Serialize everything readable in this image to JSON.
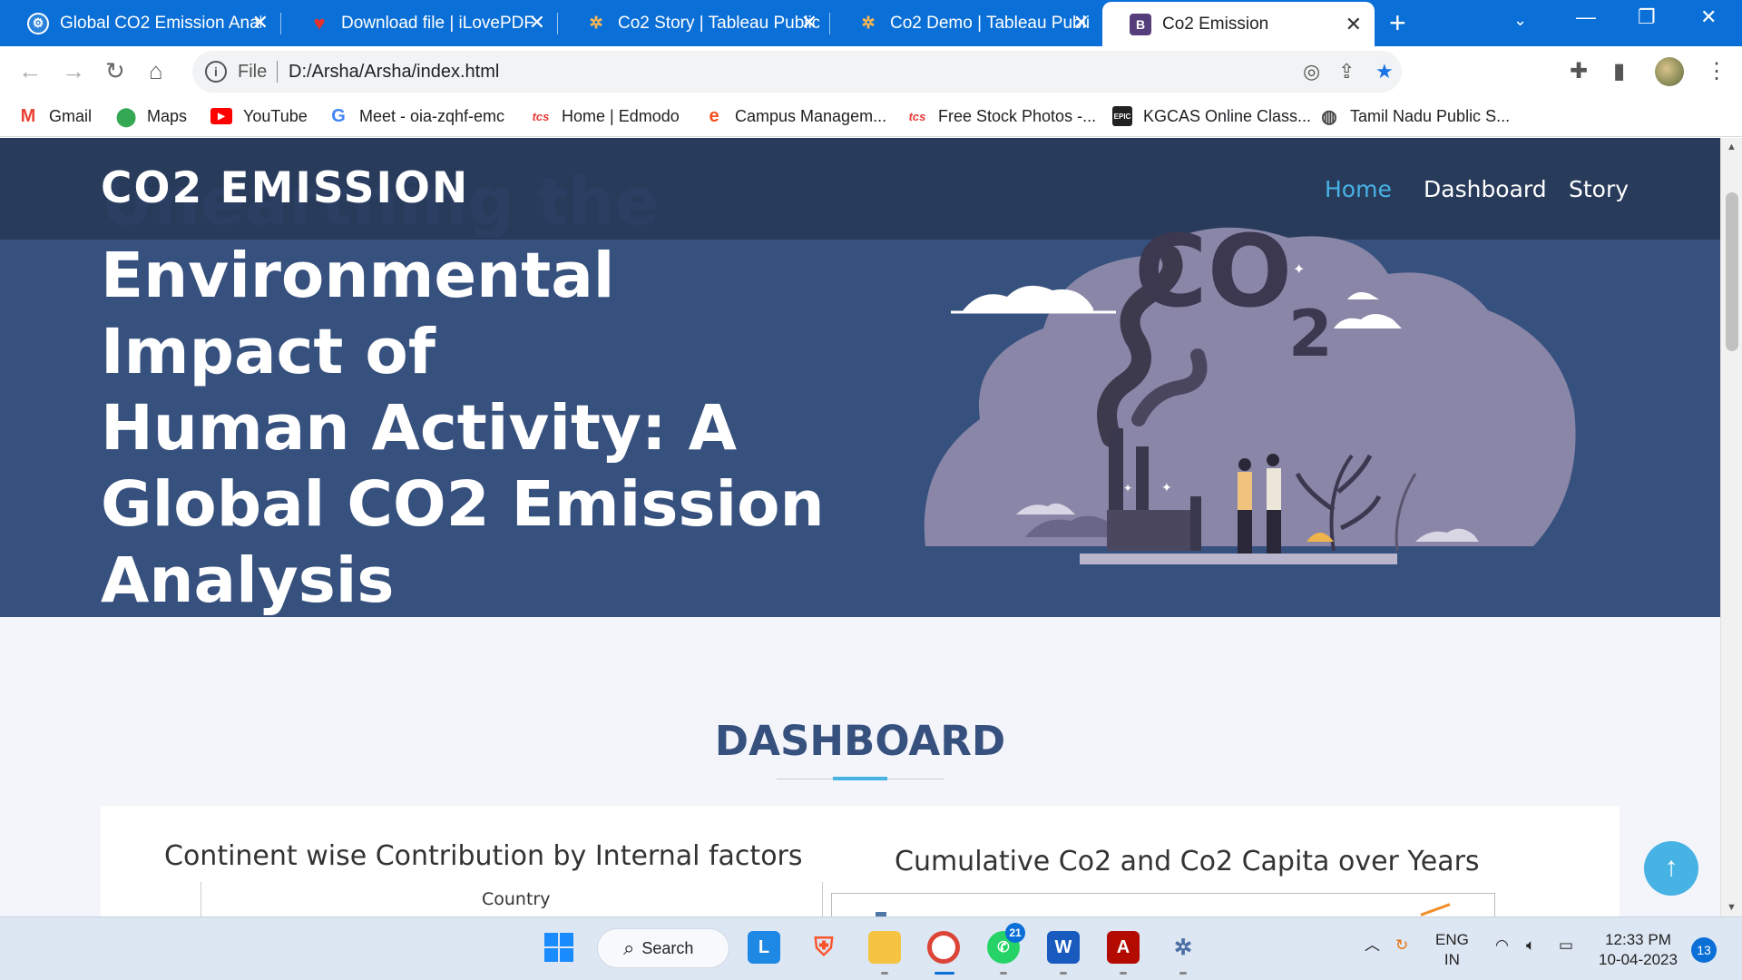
{
  "browser": {
    "tabs": [
      {
        "title": "Global CO2 Emission Anal",
        "icon": "openai-icon"
      },
      {
        "title": "Download file | iLovePDF",
        "icon": "ilovepdf-icon"
      },
      {
        "title": "Co2 Story | Tableau Public",
        "icon": "tableau-icon"
      },
      {
        "title": "Co2 Demo | Tableau Publi",
        "icon": "tableau-icon"
      },
      {
        "title": "Co2 Emission",
        "icon": "bootstrap-icon",
        "active": true
      }
    ],
    "address": {
      "prefix": "File",
      "url": "D:/Arsha/Arsha/index.html"
    },
    "bookmarks": [
      {
        "label": "Gmail",
        "icon": "gmail-icon"
      },
      {
        "label": "Maps",
        "icon": "maps-icon"
      },
      {
        "label": "YouTube",
        "icon": "youtube-icon"
      },
      {
        "label": "Meet - oia-zqhf-emc",
        "icon": "google-icon"
      },
      {
        "label": "Home | Edmodo",
        "icon": "tcs-icon"
      },
      {
        "label": "Campus Managem...",
        "icon": "campus-icon"
      },
      {
        "label": "Free Stock Photos -...",
        "icon": "tcs-icon"
      },
      {
        "label": "KGCAS Online Class...",
        "icon": "epic-icon"
      },
      {
        "label": "Tamil Nadu Public S...",
        "icon": "globe-icon"
      }
    ]
  },
  "site": {
    "logo": "CO2 EMISSION",
    "ghost_text": "Unearthing the",
    "nav": {
      "home": "Home",
      "dashboard": "Dashboard",
      "story": "Story"
    },
    "hero": {
      "line1": "Environmental Impact of",
      "line2": "Human Activity: A",
      "line3": "Global CO2 Emission",
      "line4": "Analysis"
    },
    "illustration": {
      "label_co": "CO",
      "label_2": "2"
    },
    "section_title": "DASHBOARD",
    "charts": {
      "chart1_title": "Continent wise Contribution by Internal factors",
      "chart1_sub": "Country",
      "chart2_title": "Cumulative Co2 and Co2 Capita over Years"
    },
    "back_to_top": "↑"
  },
  "taskbar": {
    "search": "Search",
    "whatsapp_badge": "21",
    "lang_line1": "ENG",
    "lang_line2": "IN",
    "time": "12:33 PM",
    "date": "10-04-2023",
    "notif_count": "13"
  },
  "colors": {
    "accent": "#47b2e4",
    "hero_bg": "#37517e",
    "header_bg": "#283a5a",
    "chrome_blue": "#0a6fd6"
  }
}
